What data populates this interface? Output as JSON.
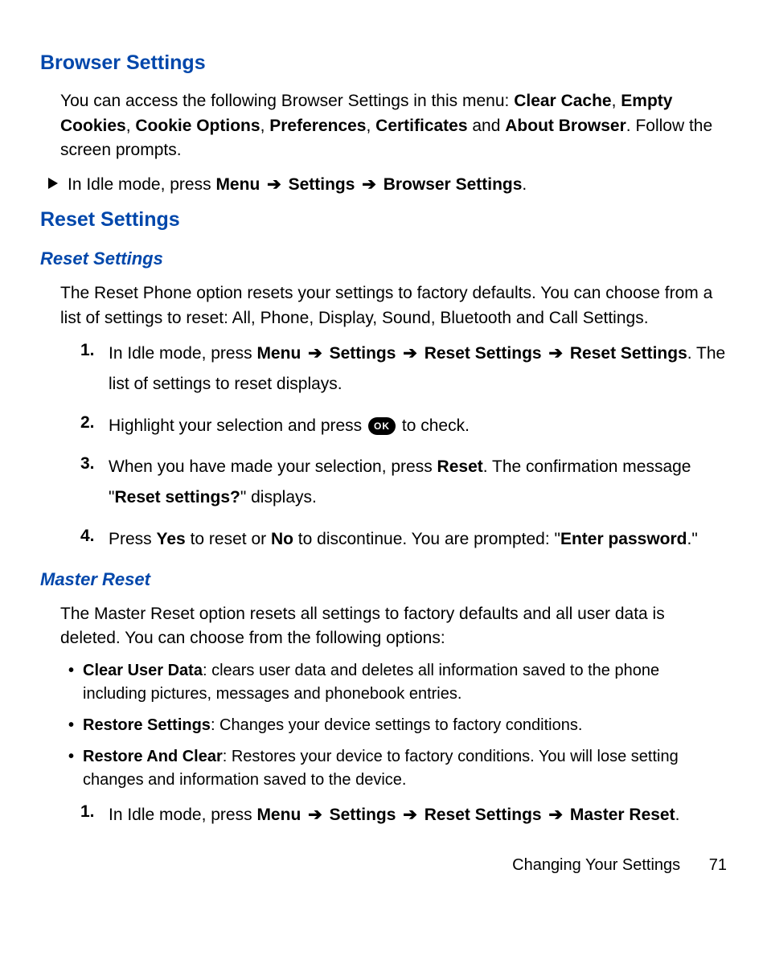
{
  "browser": {
    "heading": "Browser Settings",
    "intro_a": "You can access the following Browser Settings in this menu: ",
    "b1": "Clear Cache",
    "c1": ", ",
    "b2": "Empty Cookies",
    "c2": ", ",
    "b3": "Cookie Options",
    "c3": ", ",
    "b4": "Preferences",
    "c4": ", ",
    "b5": "Certificates",
    "c5": " and ",
    "b6": "About Browser",
    "intro_b": ". Follow the screen prompts.",
    "nav_a": "In Idle mode, press ",
    "nav_menu": "Menu",
    "nav_arrow": "➔",
    "nav_settings": "Settings",
    "nav_target": "Browser Settings",
    "nav_end": "."
  },
  "reset": {
    "heading": "Reset Settings",
    "sub1": "Reset Settings",
    "para1": "The Reset Phone option resets your settings to factory defaults. You can choose from a list of settings to reset: All, Phone, Display, Sound, Bluetooth and Call Settings.",
    "steps": {
      "s1a": "In Idle mode, press ",
      "s1_menu": "Menu",
      "s1_arr": "➔",
      "s1_settings": "Settings",
      "s1_rs": "Reset Settings",
      "s1_rs2": "Reset Settings",
      "s1_end": ". The list of settings to reset displays.",
      "s2a": "Highlight your selection and press ",
      "s2_ok": "OK",
      "s2b": " to check.",
      "s3a": "When you have made your selection, press ",
      "s3_reset": "Reset",
      "s3b": ". The confirmation message \"",
      "s3_msg": "Reset settings?",
      "s3c": "\" displays.",
      "s4a": "Press ",
      "s4_yes": "Yes",
      "s4b": " to reset or ",
      "s4_no": "No",
      "s4c": " to discontinue. You are prompted: \"",
      "s4_msg": "Enter password",
      "s4d": ".\""
    },
    "sub2": "Master Reset",
    "para2": "The Master Reset option resets all settings to factory defaults and all user data is deleted. You can choose from the following options:",
    "opts": {
      "o1_b": "Clear User Data",
      "o1_t": ": clears user data and deletes all information saved to the phone including pictures, messages and phonebook entries.",
      "o2_b": "Restore Settings",
      "o2_t": ": Changes your device settings to factory conditions.",
      "o3_b": "Restore And Clear",
      "o3_t": ": Restores your device to factory conditions. You will lose setting changes and information saved to the device."
    },
    "m1a": "In Idle mode, press ",
    "m1_menu": "Menu",
    "m1_arr": "➔",
    "m1_settings": "Settings",
    "m1_rs": "Reset Settings",
    "m1_mr": "Master Reset",
    "m1_end": "."
  },
  "footer": {
    "section": "Changing Your Settings",
    "page": "71"
  },
  "nums": {
    "n1": "1.",
    "n2": "2.",
    "n3": "3.",
    "n4": "4."
  }
}
